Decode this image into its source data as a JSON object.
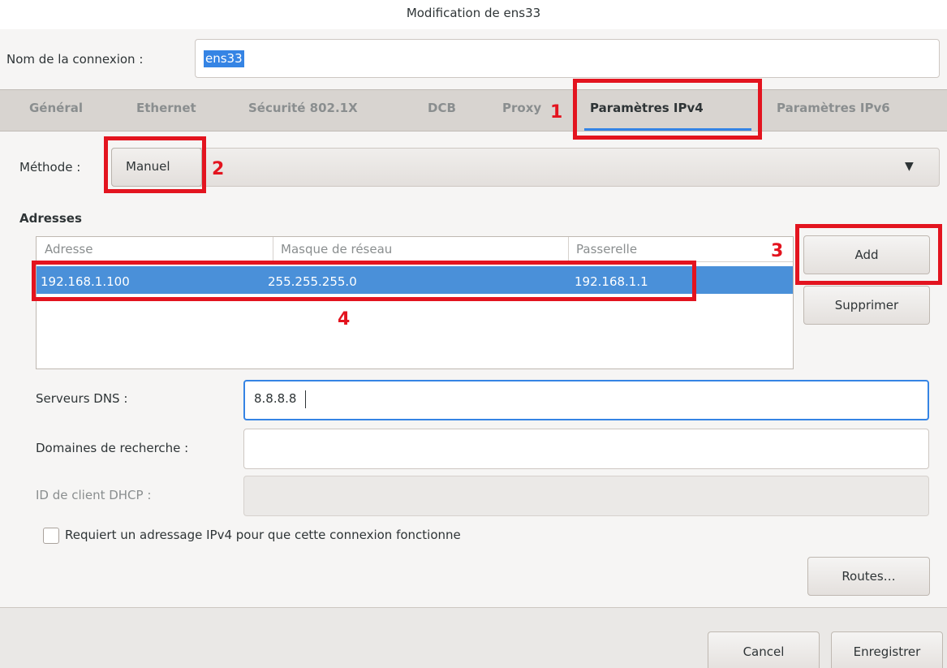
{
  "window": {
    "title": "Modification de ens33"
  },
  "connection": {
    "label": "Nom de la connexion :",
    "value": "ens33"
  },
  "tabs": [
    {
      "label": "Général"
    },
    {
      "label": "Ethernet"
    },
    {
      "label": "Sécurité 802.1X"
    },
    {
      "label": "DCB"
    },
    {
      "label": "Proxy"
    },
    {
      "label": "Paramètres IPv4",
      "active": true
    },
    {
      "label": "Paramètres IPv6"
    }
  ],
  "method": {
    "label": "Méthode :",
    "value": "Manuel",
    "icon": "chevron-down-icon"
  },
  "addresses": {
    "heading": "Adresses",
    "columns": [
      "Adresse",
      "Masque de réseau",
      "Passerelle"
    ],
    "rows": [
      [
        "192.168.1.100",
        "255.255.255.0",
        "192.168.1.1"
      ]
    ],
    "add_label": "Add",
    "remove_label": "Supprimer"
  },
  "dns": {
    "label": "Serveurs DNS :",
    "value": "8.8.8.8"
  },
  "search": {
    "label": "Domaines de recherche :",
    "value": ""
  },
  "dhcp": {
    "label": "ID de client DHCP :",
    "value": ""
  },
  "require": {
    "label": "Requiert un adressage IPv4 pour que cette connexion fonctionne",
    "checked": false
  },
  "routes_label": "Routes…",
  "footer": {
    "cancel_label": "Cancel",
    "save_label": "Enregistrer"
  },
  "annotations": {
    "n1": "1",
    "n2": "2",
    "n3": "3",
    "n4": "4",
    "color": "#e3141f"
  },
  "colors": {
    "accent": "#3584e4",
    "selection": "#4a90d9"
  }
}
